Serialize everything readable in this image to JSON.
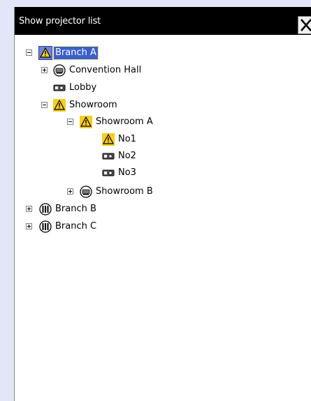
{
  "window": {
    "title": "Show projector list"
  },
  "tree": {
    "branch_a": "Branch A",
    "convention_hall": "Convention Hall",
    "lobby": "Lobby",
    "showroom": "Showroom",
    "showroom_a": "Showroom A",
    "no1": "No1",
    "no2": "No2",
    "no3": "No3",
    "showroom_b": "Showroom B",
    "branch_b": "Branch B",
    "branch_c": "Branch C"
  },
  "icons": {
    "warning": "warning-icon",
    "group": "group-icon",
    "projector": "projector-icon",
    "close": "close-icon"
  },
  "colors": {
    "selection": "#3b5fcd",
    "warning": "#f7cc1d",
    "titlebar": "#000000",
    "sidebar": "#e2e6f6"
  }
}
